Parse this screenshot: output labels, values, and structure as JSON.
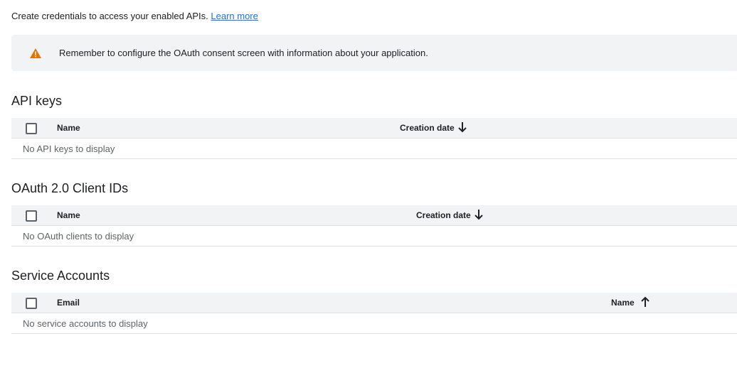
{
  "intro": {
    "text": "Create credentials to access your enabled APIs.",
    "link": "Learn more"
  },
  "banner": {
    "icon": "warning-icon",
    "message": "Remember to configure the OAuth consent screen with information about your application."
  },
  "api_keys": {
    "title": "API keys",
    "columns": [
      "Name",
      "Creation date"
    ],
    "sort_icon": "arrow-down-icon",
    "empty": "No API keys to display"
  },
  "oauth": {
    "title": "OAuth 2.0 Client IDs",
    "columns": [
      "Name",
      "Creation date"
    ],
    "sort_icon": "arrow-down-icon",
    "empty": "No OAuth clients to display"
  },
  "service_accounts": {
    "title": "Service Accounts",
    "columns": [
      "Email",
      "Name"
    ],
    "sort_icon": "arrow-up-icon",
    "empty": "No service accounts to display"
  },
  "colors": {
    "link": "#1a73e8",
    "warning": "#e37400",
    "header_bg": "#f1f3f4"
  }
}
